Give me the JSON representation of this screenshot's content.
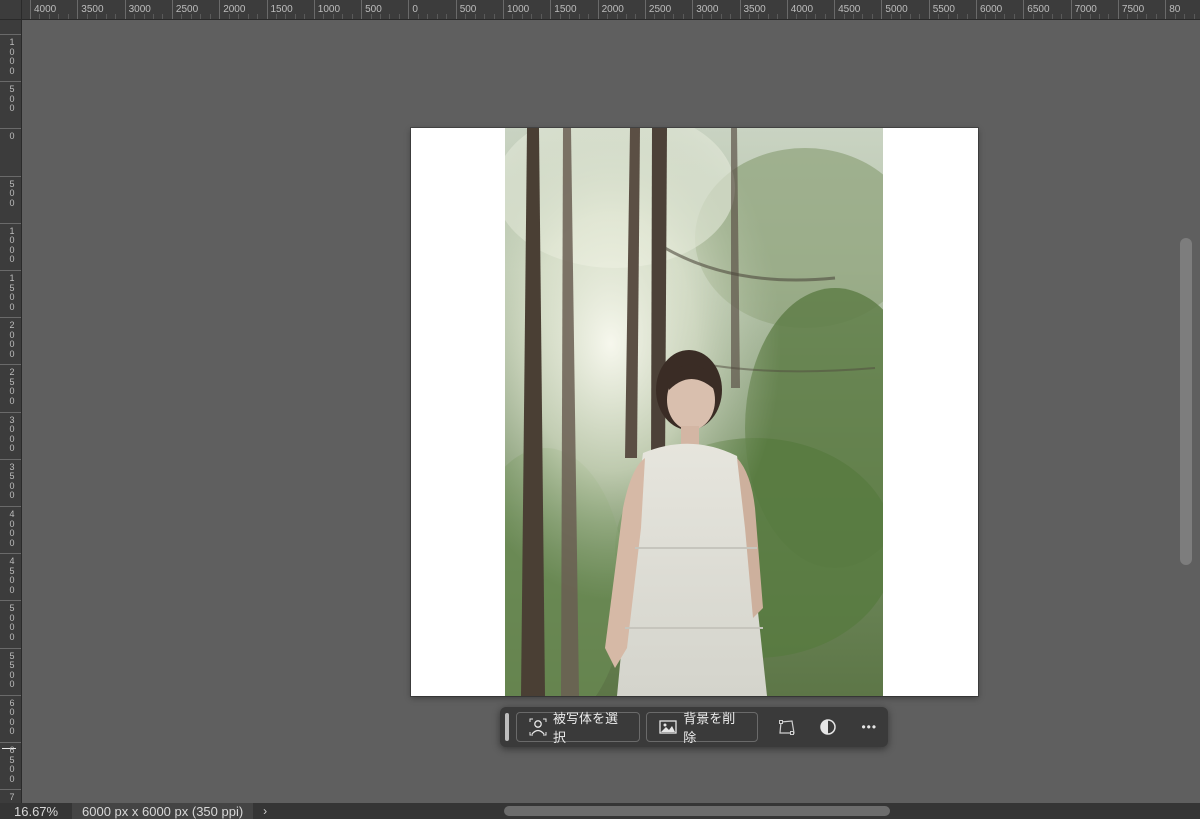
{
  "ruler_top": {
    "labels": [
      "4000",
      "3500",
      "3000",
      "2500",
      "2000",
      "1500",
      "1000",
      "500",
      "0",
      "500",
      "1000",
      "1500",
      "2000",
      "2500",
      "3000",
      "3500",
      "4000",
      "4500",
      "5000",
      "5500",
      "6000",
      "6500",
      "7000",
      "7500",
      "80"
    ]
  },
  "ruler_left": {
    "labels": [
      "1000",
      "500",
      "0",
      "500",
      "1000",
      "1500",
      "2000",
      "2500",
      "3000",
      "3500",
      "4000",
      "4500",
      "5000",
      "5500",
      "6000",
      "6500",
      "7"
    ]
  },
  "taskbar": {
    "select_subject_label": "被写体を選択",
    "remove_background_label": "背景を削除",
    "more_label": "•••"
  },
  "status": {
    "zoom": "16.67%",
    "doc_info": "6000 px x 6000 px (350 ppi)",
    "expand": "›"
  },
  "colors": {
    "workspace": "#5f5f5f",
    "ruler": "#3c3c3c",
    "taskbar": "#3a3a3a",
    "canvas": "#ffffff"
  }
}
